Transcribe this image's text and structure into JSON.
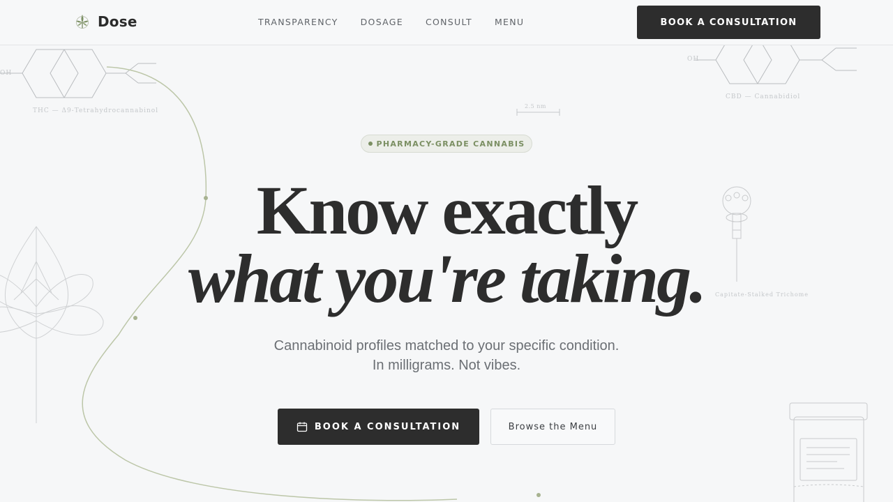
{
  "header": {
    "brand_name": "Dose",
    "logo_icon": "cannabis-leaf-icon",
    "nav": [
      {
        "label": "TRANSPARENCY"
      },
      {
        "label": "DOSAGE"
      },
      {
        "label": "CONSULT"
      },
      {
        "label": "MENU"
      }
    ],
    "cta_label": "BOOK A CONSULTATION"
  },
  "decor": {
    "thc_label": "THC — Δ9-Tetrahydrocannabinol",
    "cbd_label": "CBD — Cannabidiol",
    "oh_label": "OH",
    "scale_label": "2.5 nm",
    "trichome_label": "Capitate-Stalked Trichome"
  },
  "hero": {
    "badge": "PHARMACY-GRADE CANNABIS",
    "headline_line1": "Know exactly",
    "headline_line2": "what you're taking.",
    "subtitle_line1": "Cannabinoid profiles matched to your specific condition.",
    "subtitle_line2": "In milligrams. Not vibes.",
    "primary_cta": "BOOK A CONSULTATION",
    "primary_cta_icon": "calendar-icon",
    "secondary_cta": "Browse the Menu"
  },
  "colors": {
    "dark": "#2d2d2d",
    "accent_green": "#7b8f63",
    "background": "#f6f7f8"
  }
}
